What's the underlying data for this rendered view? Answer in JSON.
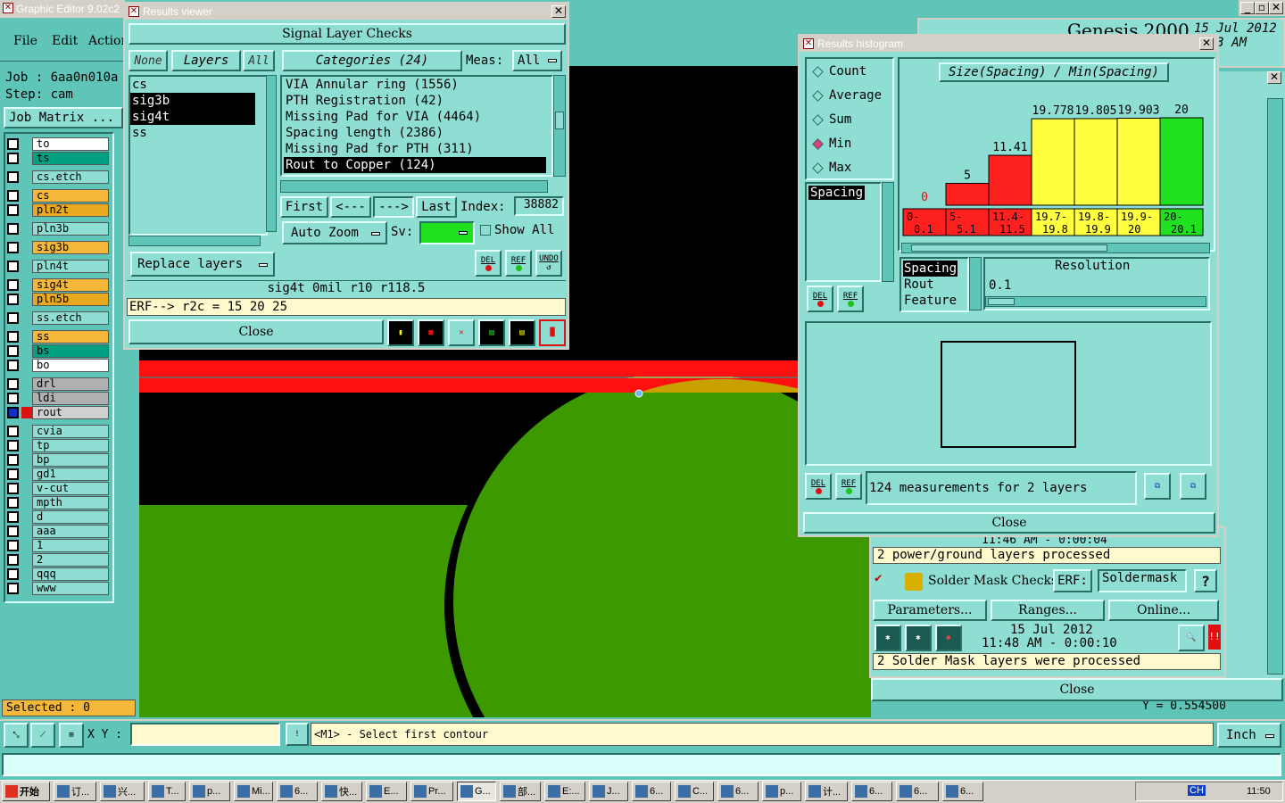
{
  "main_window": {
    "title": "Graphic Editor 9.02c2",
    "menu": [
      "File",
      "Edit",
      "Action"
    ],
    "job_label": "Job : 6aa0n010a",
    "step_label": "Step: cam",
    "job_matrix_button": "Job Matrix ...",
    "selected_label": "Selected : 0",
    "xy_label": "X Y :",
    "message": "<M1> - Select first contour",
    "units": "Inch",
    "genesis_title": "Genesis 2000",
    "date": "15 Jul 2012",
    "time": ": 13 AM",
    "y_readout": "Y = 0.554500"
  },
  "layers": [
    {
      "name": "to",
      "color": "#ffffff"
    },
    {
      "name": "ts",
      "color": "#00a080"
    },
    {
      "name": "cs.etch",
      "color": "#8fded3"
    },
    {
      "name": "cs",
      "color": "#f3b73a"
    },
    {
      "name": "pln2t",
      "color": "#e8a820"
    },
    {
      "name": "pln3b",
      "color": "#8fded3"
    },
    {
      "name": "sig3b",
      "color": "#f3b73a"
    },
    {
      "name": "pln4t",
      "color": "#8fded3"
    },
    {
      "name": "sig4t",
      "color": "#f3b73a"
    },
    {
      "name": "pln5b",
      "color": "#e8a820"
    },
    {
      "name": "ss.etch",
      "color": "#8fded3"
    },
    {
      "name": "ss",
      "color": "#f3b73a"
    },
    {
      "name": "bs",
      "color": "#00a080"
    },
    {
      "name": "bo",
      "color": "#ffffff"
    },
    {
      "name": "drl",
      "color": "#b0b0b0"
    },
    {
      "name": "ldi",
      "color": "#b0b0b0"
    },
    {
      "name": "rout",
      "color": "#d0d0d0"
    },
    {
      "name": "cvia",
      "color": "#8fded3"
    },
    {
      "name": "tp",
      "color": "#8fded3"
    },
    {
      "name": "bp",
      "color": "#8fded3"
    },
    {
      "name": "gd1",
      "color": "#8fded3"
    },
    {
      "name": "v-cut",
      "color": "#8fded3"
    },
    {
      "name": "mpth",
      "color": "#8fded3"
    },
    {
      "name": "d",
      "color": "#8fded3"
    },
    {
      "name": "aaa",
      "color": "#8fded3"
    },
    {
      "name": "1",
      "color": "#8fded3"
    },
    {
      "name": "2",
      "color": "#8fded3"
    },
    {
      "name": "qqq",
      "color": "#8fded3"
    },
    {
      "name": "www",
      "color": "#8fded3"
    }
  ],
  "results_viewer": {
    "title": "Results viewer",
    "header": "Signal Layer Checks",
    "btn_none": "None",
    "btn_layers": "Layers",
    "btn_all": "All",
    "categories_label": "Categories (24)",
    "meas_label": "Meas:",
    "meas_value": "All",
    "layer_list": [
      "cs",
      "sig3b",
      "sig4t",
      "ss"
    ],
    "categories": [
      "VIA Annular ring (1556)",
      "PTH Registration (42)",
      "Missing Pad for VIA (4464)",
      "Spacing length (2386)",
      "Missing Pad for PTH (311)",
      "Rout to Copper (124)"
    ],
    "btn_first": "First",
    "btn_prev": "<---",
    "btn_next": "--->",
    "btn_last": "Last",
    "index_label": "Index:",
    "index_value": "38882",
    "auto_zoom": "Auto Zoom",
    "sv_label": "Sv:",
    "show_all": "Show All",
    "replace_layers": "Replace layers",
    "status": "sig4t 0mil  r10  r118.5",
    "erf": "ERF--> r2c = 15 20 25",
    "close": "Close",
    "del": "DEL",
    "ref": "REF",
    "undo": "UNDO"
  },
  "histogram": {
    "title": "Results histogram",
    "options": [
      "Count",
      "Average",
      "Sum",
      "Min",
      "Max"
    ],
    "selected_option": "Min",
    "chart_title": "Size(Spacing) / Min(Spacing)",
    "list": [
      "Spacing"
    ],
    "measure_list": [
      "Spacing",
      "Rout",
      "Feature"
    ],
    "resolution_label": "Resolution",
    "resolution_value": "0.1",
    "summary": "124 measurements for 2 layers",
    "close": "Close",
    "del": "DEL",
    "ref": "REF"
  },
  "chart_data": {
    "type": "bar",
    "title": "Size(Spacing) / Min(Spacing)",
    "categories": [
      "0-\n0.1",
      "5-\n5.1",
      "11.4-\n11.5",
      "19.7-\n19.8",
      "19.8-\n19.9",
      "19.9-\n20",
      "20-\n20.1"
    ],
    "values": [
      0,
      5,
      11.41,
      19.778,
      19.805,
      19.903,
      20
    ],
    "value_labels": [
      "0",
      "5",
      "11.41",
      "19.778",
      "19.805",
      "19.903",
      "20"
    ],
    "colors": [
      "#ff2020",
      "#ff2020",
      "#ff2020",
      "#ffff40",
      "#ffff40",
      "#ffff40",
      "#20e020"
    ],
    "ylim": [
      0,
      20
    ]
  },
  "checks_panel": {
    "time_row_1": "11:46 AM - 0:00:04",
    "pg_message": "2 power/ground layers processed",
    "section": "Solder Mask Checks",
    "erf_label": "ERF:",
    "erf_value": "Soldermask",
    "help": "?",
    "btn_parameters": "Parameters...",
    "btn_ranges": "Ranges...",
    "btn_online": "Online...",
    "date": "15 Jul 2012",
    "time": "11:48 AM - 0:00:10",
    "sm_message": "2 Solder Mask layers were processed",
    "close": "Close",
    "alert": "!!"
  },
  "taskbar": {
    "start": "开始",
    "items": [
      "订...",
      "兴...",
      "T...",
      "p...",
      "Mi...",
      "6...",
      "快...",
      "E...",
      "Pr...",
      "G...",
      "部...",
      "E:...",
      "J...",
      "6...",
      "C...",
      "6...",
      "p...",
      "计...",
      "6...",
      "6...",
      "6..."
    ],
    "tray_lang": "CH",
    "clock": "11:50"
  }
}
